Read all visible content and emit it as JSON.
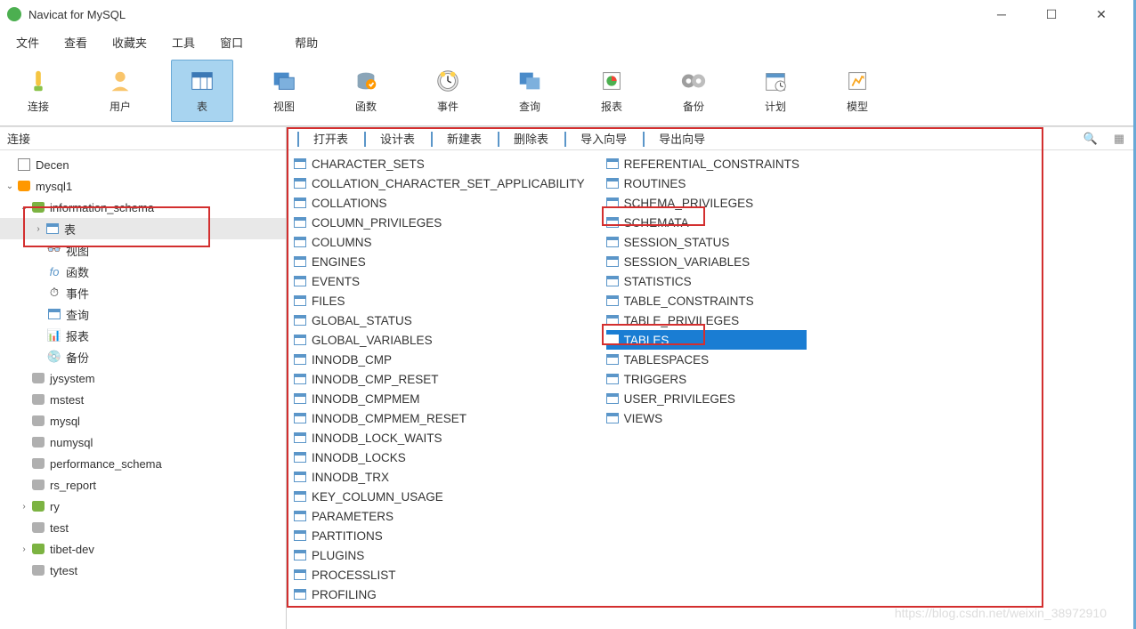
{
  "title": "Navicat for MySQL",
  "menu": {
    "file": "文件",
    "view": "查看",
    "fav": "收藏夹",
    "tools": "工具",
    "window": "窗口",
    "help": "帮助"
  },
  "toolbar": {
    "connect": "连接",
    "user": "用户",
    "table": "表",
    "view": "视图",
    "function": "函数",
    "event": "事件",
    "query": "查询",
    "report": "报表",
    "backup": "备份",
    "schedule": "计划",
    "model": "模型"
  },
  "side_header": "连接",
  "tree": {
    "conn1": "Decen",
    "conn2": "mysql1",
    "db_open": "information_schema",
    "sub": {
      "table": "表",
      "view": "视图",
      "func": "函数",
      "event": "事件",
      "query": "查询",
      "report": "报表",
      "backup": "备份"
    },
    "dbs": [
      "jysystem",
      "mstest",
      "mysql",
      "numysql",
      "performance_schema",
      "rs_report",
      "ry",
      "test",
      "tibet-dev",
      "tytest"
    ]
  },
  "objbar": {
    "open": "打开表",
    "design": "设计表",
    "new": "新建表",
    "delete": "删除表",
    "import": "导入向导",
    "export": "导出向导"
  },
  "tables_col1": [
    "CHARACTER_SETS",
    "COLLATION_CHARACTER_SET_APPLICABILITY",
    "COLLATIONS",
    "COLUMN_PRIVILEGES",
    "COLUMNS",
    "ENGINES",
    "EVENTS",
    "FILES",
    "GLOBAL_STATUS",
    "GLOBAL_VARIABLES",
    "INNODB_CMP",
    "INNODB_CMP_RESET",
    "INNODB_CMPMEM",
    "INNODB_CMPMEM_RESET",
    "INNODB_LOCK_WAITS",
    "INNODB_LOCKS",
    "INNODB_TRX",
    "KEY_COLUMN_USAGE",
    "PARAMETERS",
    "PARTITIONS",
    "PLUGINS",
    "PROCESSLIST",
    "PROFILING"
  ],
  "tables_col2": [
    "REFERENTIAL_CONSTRAINTS",
    "ROUTINES",
    "SCHEMA_PRIVILEGES",
    "SCHEMATA",
    "SESSION_STATUS",
    "SESSION_VARIABLES",
    "STATISTICS",
    "TABLE_CONSTRAINTS",
    "TABLE_PRIVILEGES",
    "TABLES",
    "TABLESPACES",
    "TRIGGERS",
    "USER_PRIVILEGES",
    "VIEWS"
  ],
  "selected_table": "TABLES",
  "watermark": "https://blog.csdn.net/weixin_38972910"
}
